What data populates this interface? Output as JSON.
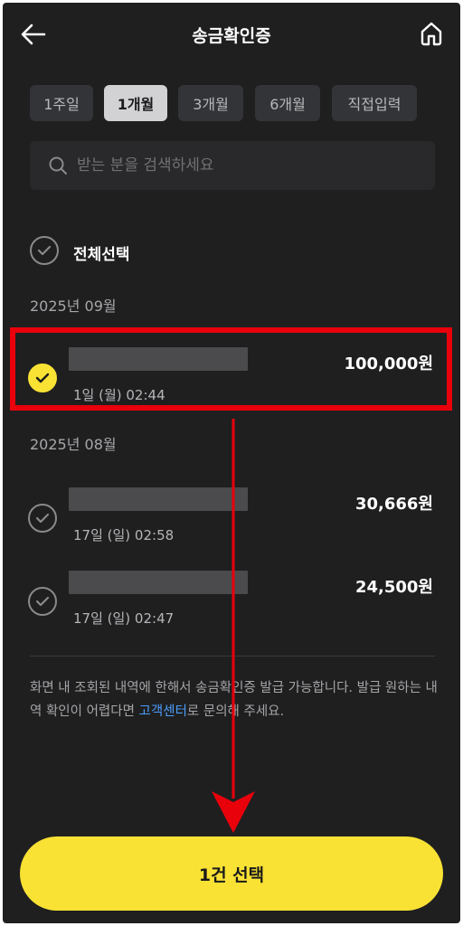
{
  "header": {
    "title": "송금확인증"
  },
  "tabs": [
    {
      "label": "1주일",
      "active": false
    },
    {
      "label": "1개월",
      "active": true
    },
    {
      "label": "3개월",
      "active": false
    },
    {
      "label": "6개월",
      "active": false
    },
    {
      "label": "직접입력",
      "active": false
    }
  ],
  "search": {
    "placeholder": "받는 분을 검색하세요",
    "value": ""
  },
  "select_all": {
    "label": "전체선택",
    "checked": false
  },
  "groups": [
    {
      "month": "2025년 09월",
      "items": [
        {
          "time": "1일 (월) 02:44",
          "amount": "100,000원",
          "checked": true
        }
      ]
    },
    {
      "month": "2025년 08월",
      "items": [
        {
          "time": "17일 (일) 02:58",
          "amount": "30,666원",
          "checked": false
        },
        {
          "time": "17일 (일) 02:47",
          "amount": "24,500원",
          "checked": false
        }
      ]
    }
  ],
  "notice": {
    "before": "화면 내 조회된 내역에 한해서 송금확인증 발급 가능합니다. 발급 원하는 내역 확인이 어렵다면 ",
    "link": "고객센터",
    "after": "로 문의해 주세요."
  },
  "cta": {
    "label": "1건 선택"
  },
  "colors": {
    "accent": "#f9e234",
    "annotation": "#e8000b",
    "background": "#1f1f20",
    "link": "#4b9df9"
  }
}
